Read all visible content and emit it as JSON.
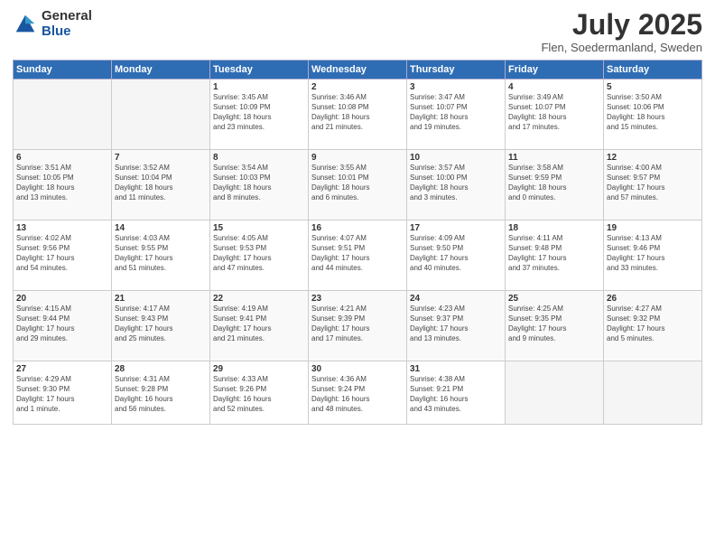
{
  "header": {
    "logo_general": "General",
    "logo_blue": "Blue",
    "month_title": "July 2025",
    "location": "Flen, Soedermanland, Sweden"
  },
  "weekdays": [
    "Sunday",
    "Monday",
    "Tuesday",
    "Wednesday",
    "Thursday",
    "Friday",
    "Saturday"
  ],
  "weeks": [
    [
      {
        "day": "",
        "info": ""
      },
      {
        "day": "",
        "info": ""
      },
      {
        "day": "1",
        "info": "Sunrise: 3:45 AM\nSunset: 10:09 PM\nDaylight: 18 hours\nand 23 minutes."
      },
      {
        "day": "2",
        "info": "Sunrise: 3:46 AM\nSunset: 10:08 PM\nDaylight: 18 hours\nand 21 minutes."
      },
      {
        "day": "3",
        "info": "Sunrise: 3:47 AM\nSunset: 10:07 PM\nDaylight: 18 hours\nand 19 minutes."
      },
      {
        "day": "4",
        "info": "Sunrise: 3:49 AM\nSunset: 10:07 PM\nDaylight: 18 hours\nand 17 minutes."
      },
      {
        "day": "5",
        "info": "Sunrise: 3:50 AM\nSunset: 10:06 PM\nDaylight: 18 hours\nand 15 minutes."
      }
    ],
    [
      {
        "day": "6",
        "info": "Sunrise: 3:51 AM\nSunset: 10:05 PM\nDaylight: 18 hours\nand 13 minutes."
      },
      {
        "day": "7",
        "info": "Sunrise: 3:52 AM\nSunset: 10:04 PM\nDaylight: 18 hours\nand 11 minutes."
      },
      {
        "day": "8",
        "info": "Sunrise: 3:54 AM\nSunset: 10:03 PM\nDaylight: 18 hours\nand 8 minutes."
      },
      {
        "day": "9",
        "info": "Sunrise: 3:55 AM\nSunset: 10:01 PM\nDaylight: 18 hours\nand 6 minutes."
      },
      {
        "day": "10",
        "info": "Sunrise: 3:57 AM\nSunset: 10:00 PM\nDaylight: 18 hours\nand 3 minutes."
      },
      {
        "day": "11",
        "info": "Sunrise: 3:58 AM\nSunset: 9:59 PM\nDaylight: 18 hours\nand 0 minutes."
      },
      {
        "day": "12",
        "info": "Sunrise: 4:00 AM\nSunset: 9:57 PM\nDaylight: 17 hours\nand 57 minutes."
      }
    ],
    [
      {
        "day": "13",
        "info": "Sunrise: 4:02 AM\nSunset: 9:56 PM\nDaylight: 17 hours\nand 54 minutes."
      },
      {
        "day": "14",
        "info": "Sunrise: 4:03 AM\nSunset: 9:55 PM\nDaylight: 17 hours\nand 51 minutes."
      },
      {
        "day": "15",
        "info": "Sunrise: 4:05 AM\nSunset: 9:53 PM\nDaylight: 17 hours\nand 47 minutes."
      },
      {
        "day": "16",
        "info": "Sunrise: 4:07 AM\nSunset: 9:51 PM\nDaylight: 17 hours\nand 44 minutes."
      },
      {
        "day": "17",
        "info": "Sunrise: 4:09 AM\nSunset: 9:50 PM\nDaylight: 17 hours\nand 40 minutes."
      },
      {
        "day": "18",
        "info": "Sunrise: 4:11 AM\nSunset: 9:48 PM\nDaylight: 17 hours\nand 37 minutes."
      },
      {
        "day": "19",
        "info": "Sunrise: 4:13 AM\nSunset: 9:46 PM\nDaylight: 17 hours\nand 33 minutes."
      }
    ],
    [
      {
        "day": "20",
        "info": "Sunrise: 4:15 AM\nSunset: 9:44 PM\nDaylight: 17 hours\nand 29 minutes."
      },
      {
        "day": "21",
        "info": "Sunrise: 4:17 AM\nSunset: 9:43 PM\nDaylight: 17 hours\nand 25 minutes."
      },
      {
        "day": "22",
        "info": "Sunrise: 4:19 AM\nSunset: 9:41 PM\nDaylight: 17 hours\nand 21 minutes."
      },
      {
        "day": "23",
        "info": "Sunrise: 4:21 AM\nSunset: 9:39 PM\nDaylight: 17 hours\nand 17 minutes."
      },
      {
        "day": "24",
        "info": "Sunrise: 4:23 AM\nSunset: 9:37 PM\nDaylight: 17 hours\nand 13 minutes."
      },
      {
        "day": "25",
        "info": "Sunrise: 4:25 AM\nSunset: 9:35 PM\nDaylight: 17 hours\nand 9 minutes."
      },
      {
        "day": "26",
        "info": "Sunrise: 4:27 AM\nSunset: 9:32 PM\nDaylight: 17 hours\nand 5 minutes."
      }
    ],
    [
      {
        "day": "27",
        "info": "Sunrise: 4:29 AM\nSunset: 9:30 PM\nDaylight: 17 hours\nand 1 minute."
      },
      {
        "day": "28",
        "info": "Sunrise: 4:31 AM\nSunset: 9:28 PM\nDaylight: 16 hours\nand 56 minutes."
      },
      {
        "day": "29",
        "info": "Sunrise: 4:33 AM\nSunset: 9:26 PM\nDaylight: 16 hours\nand 52 minutes."
      },
      {
        "day": "30",
        "info": "Sunrise: 4:36 AM\nSunset: 9:24 PM\nDaylight: 16 hours\nand 48 minutes."
      },
      {
        "day": "31",
        "info": "Sunrise: 4:38 AM\nSunset: 9:21 PM\nDaylight: 16 hours\nand 43 minutes."
      },
      {
        "day": "",
        "info": ""
      },
      {
        "day": "",
        "info": ""
      }
    ]
  ]
}
